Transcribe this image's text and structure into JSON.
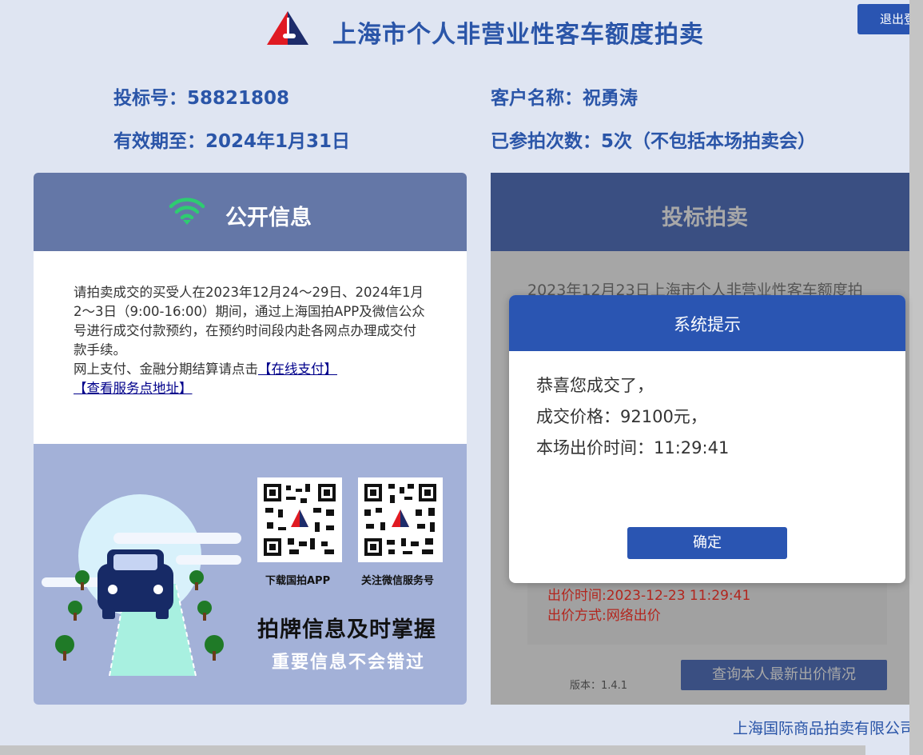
{
  "header": {
    "title": "上海市个人非营业性客车额度拍卖",
    "logout_label": "退出登录"
  },
  "info": {
    "bid_number": "投标号：58821808",
    "customer_name": "客户名称：祝勇涛",
    "valid_until": "有效期至：2024年1月31日",
    "participation_count": "已参拍次数：5次（不包括本场拍卖会）"
  },
  "left_panel": {
    "title": "公开信息",
    "notice_text": "请拍卖成交的买受人在2023年12月24～29日、2024年1月2～3日（9:00-16:00）期间，通过上海国拍APP及微信公众号进行成交付款预约，在预约时间段内赴各网点办理成交付款手续。",
    "payment_prefix": "网上支付、金融分期结算请点击",
    "online_pay_link": "【在线支付】",
    "service_link": "【查看服务点地址】",
    "qr_app_label": "下载国拍APP",
    "qr_wechat_label": "关注微信服务号",
    "slogan_main": "拍牌信息及时掌握",
    "slogan_sub": "重要信息不会错过"
  },
  "right_panel": {
    "title": "投标拍卖",
    "auction_text": "2023年12月23日上海市个人非营业性客车额度拍",
    "bid_time": "出价时间:2023-12-23 11:29:41",
    "bid_method": "出价方式:网络出价",
    "version": "版本：1.4.1",
    "query_button": "查询本人最新出价情况"
  },
  "footer": {
    "company": "上海国际商品拍卖有限公司"
  },
  "modal": {
    "title": "系统提示",
    "line1": "恭喜您成交了，",
    "line2": "成交价格：92100元，",
    "line3": "本场出价时间：11:29:41",
    "ok_label": "确定"
  },
  "colors": {
    "primary": "#2a55b2",
    "heading_text": "#2a55a8",
    "left_header": "#6477a7",
    "right_header": "#3a4f82",
    "bid_text": "#b3261e",
    "wifi_green": "#2ecc71"
  },
  "icons": {
    "logo": "auction-logo-icon",
    "wifi": "wifi-icon",
    "qr": "qr-code-icon"
  }
}
